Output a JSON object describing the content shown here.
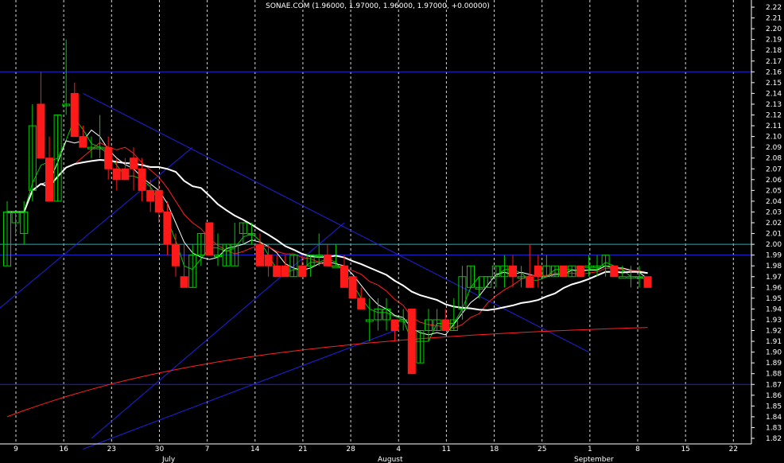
{
  "chart_data": {
    "type": "candlestick",
    "title": "SONAE.COM (1.96000, 1.97000, 1.96000, 1.97000, +0.00000)",
    "y_ticks": [
      "2.22",
      "2.21",
      "2.20",
      "2.19",
      "2.18",
      "2.17",
      "2.16",
      "2.15",
      "2.14",
      "2.13",
      "2.12",
      "2.11",
      "2.10",
      "2.09",
      "2.08",
      "2.07",
      "2.06",
      "2.05",
      "2.04",
      "2.03",
      "2.02",
      "2.01",
      "2.00",
      "1.99",
      "1.98",
      "1.97",
      "1.96",
      "1.95",
      "1.94",
      "1.93",
      "1.92",
      "1.91",
      "1.90",
      "1.89",
      "1.88",
      "1.87",
      "1.86",
      "1.85",
      "1.84",
      "1.83",
      "1.82"
    ],
    "ylim": [
      1.82,
      2.22
    ],
    "x_day_ticks": [
      "9",
      "16",
      "23",
      "30",
      "7",
      "14",
      "21",
      "28",
      "4",
      "11",
      "18",
      "25",
      "1",
      "8",
      "15",
      "22"
    ],
    "x_month_ticks": [
      "July",
      "August",
      "September"
    ],
    "grid": "vertical dotted",
    "candles": [
      {
        "o": 1.98,
        "h": 2.04,
        "l": 1.98,
        "c": 2.03
      },
      {
        "o": 2.02,
        "h": 2.03,
        "l": 2.01,
        "c": 2.03
      },
      {
        "o": 2.01,
        "h": 2.04,
        "l": 2.0,
        "c": 2.03
      },
      {
        "o": 2.05,
        "h": 2.13,
        "l": 2.04,
        "c": 2.11
      },
      {
        "o": 2.13,
        "h": 2.16,
        "l": 2.08,
        "c": 2.08
      },
      {
        "o": 2.08,
        "h": 2.1,
        "l": 2.04,
        "c": 2.04
      },
      {
        "o": 2.04,
        "h": 2.12,
        "l": 2.04,
        "c": 2.12
      },
      {
        "o": 2.13,
        "h": 2.19,
        "l": 2.12,
        "c": 2.13
      },
      {
        "o": 2.14,
        "h": 2.15,
        "l": 2.1,
        "c": 2.1
      },
      {
        "o": 2.1,
        "h": 2.11,
        "l": 2.09,
        "c": 2.09
      },
      {
        "o": 2.09,
        "h": 2.1,
        "l": 2.08,
        "c": 2.09
      },
      {
        "o": 2.09,
        "h": 2.12,
        "l": 2.08,
        "c": 2.09
      },
      {
        "o": 2.09,
        "h": 2.1,
        "l": 2.06,
        "c": 2.07
      },
      {
        "o": 2.07,
        "h": 2.08,
        "l": 2.05,
        "c": 2.06
      },
      {
        "o": 2.07,
        "h": 2.08,
        "l": 2.06,
        "c": 2.06
      },
      {
        "o": 2.08,
        "h": 2.09,
        "l": 2.05,
        "c": 2.07
      },
      {
        "o": 2.07,
        "h": 2.08,
        "l": 2.04,
        "c": 2.05
      },
      {
        "o": 2.05,
        "h": 2.06,
        "l": 2.03,
        "c": 2.04
      },
      {
        "o": 2.05,
        "h": 2.06,
        "l": 2.02,
        "c": 2.03
      },
      {
        "o": 2.03,
        "h": 2.04,
        "l": 1.99,
        "c": 2.0
      },
      {
        "o": 2.0,
        "h": 2.01,
        "l": 1.97,
        "c": 1.98
      },
      {
        "o": 1.97,
        "h": 2.0,
        "l": 1.96,
        "c": 1.96
      },
      {
        "o": 1.96,
        "h": 2.0,
        "l": 1.96,
        "c": 1.99
      },
      {
        "o": 1.99,
        "h": 2.01,
        "l": 1.98,
        "c": 2.01
      },
      {
        "o": 2.02,
        "h": 2.02,
        "l": 1.99,
        "c": 1.99
      },
      {
        "o": 1.99,
        "h": 2.01,
        "l": 1.98,
        "c": 1.99
      },
      {
        "o": 1.98,
        "h": 2.0,
        "l": 1.98,
        "c": 2.0
      },
      {
        "o": 1.98,
        "h": 2.02,
        "l": 1.98,
        "c": 2.0
      },
      {
        "o": 2.01,
        "h": 2.02,
        "l": 2.0,
        "c": 2.02
      },
      {
        "o": 2.01,
        "h": 2.02,
        "l": 2.0,
        "c": 2.01
      },
      {
        "o": 2.0,
        "h": 2.01,
        "l": 1.98,
        "c": 1.98
      },
      {
        "o": 1.99,
        "h": 2.0,
        "l": 1.97,
        "c": 1.98
      },
      {
        "o": 1.98,
        "h": 1.99,
        "l": 1.97,
        "c": 1.97
      },
      {
        "o": 1.98,
        "h": 1.99,
        "l": 1.97,
        "c": 1.97
      },
      {
        "o": 1.97,
        "h": 1.99,
        "l": 1.97,
        "c": 1.99
      },
      {
        "o": 1.98,
        "h": 1.99,
        "l": 1.97,
        "c": 1.97
      },
      {
        "o": 1.98,
        "h": 1.99,
        "l": 1.97,
        "c": 1.99
      },
      {
        "o": 1.99,
        "h": 2.01,
        "l": 1.98,
        "c": 1.99
      },
      {
        "o": 1.99,
        "h": 2.0,
        "l": 1.98,
        "c": 1.98
      },
      {
        "o": 1.98,
        "h": 2.0,
        "l": 1.98,
        "c": 1.98
      },
      {
        "o": 1.98,
        "h": 1.99,
        "l": 1.96,
        "c": 1.96
      },
      {
        "o": 1.97,
        "h": 1.97,
        "l": 1.95,
        "c": 1.95
      },
      {
        "o": 1.95,
        "h": 1.96,
        "l": 1.94,
        "c": 1.94
      },
      {
        "o": 1.93,
        "h": 1.95,
        "l": 1.91,
        "c": 1.93
      },
      {
        "o": 1.93,
        "h": 1.95,
        "l": 1.92,
        "c": 1.94
      },
      {
        "o": 1.93,
        "h": 1.95,
        "l": 1.92,
        "c": 1.94
      },
      {
        "o": 1.93,
        "h": 1.93,
        "l": 1.91,
        "c": 1.92
      },
      {
        "o": 1.93,
        "h": 1.94,
        "l": 1.92,
        "c": 1.93
      },
      {
        "o": 1.94,
        "h": 1.94,
        "l": 1.88,
        "c": 1.88
      },
      {
        "o": 1.89,
        "h": 1.92,
        "l": 1.89,
        "c": 1.92
      },
      {
        "o": 1.92,
        "h": 1.94,
        "l": 1.91,
        "c": 1.93
      },
      {
        "o": 1.92,
        "h": 1.94,
        "l": 1.92,
        "c": 1.93
      },
      {
        "o": 1.93,
        "h": 1.94,
        "l": 1.92,
        "c": 1.92
      },
      {
        "o": 1.92,
        "h": 1.95,
        "l": 1.92,
        "c": 1.93
      },
      {
        "o": 1.94,
        "h": 1.98,
        "l": 1.93,
        "c": 1.97
      },
      {
        "o": 1.96,
        "h": 1.98,
        "l": 1.96,
        "c": 1.98
      },
      {
        "o": 1.96,
        "h": 1.97,
        "l": 1.95,
        "c": 1.96
      },
      {
        "o": 1.96,
        "h": 1.97,
        "l": 1.96,
        "c": 1.97
      },
      {
        "o": 1.97,
        "h": 1.98,
        "l": 1.96,
        "c": 1.98
      },
      {
        "o": 1.97,
        "h": 1.99,
        "l": 1.96,
        "c": 1.98
      },
      {
        "o": 1.98,
        "h": 1.99,
        "l": 1.96,
        "c": 1.97
      },
      {
        "o": 1.97,
        "h": 1.98,
        "l": 1.96,
        "c": 1.97
      },
      {
        "o": 1.97,
        "h": 2.0,
        "l": 1.96,
        "c": 1.96
      },
      {
        "o": 1.98,
        "h": 1.99,
        "l": 1.96,
        "c": 1.97
      },
      {
        "o": 1.97,
        "h": 1.99,
        "l": 1.97,
        "c": 1.98
      },
      {
        "o": 1.97,
        "h": 1.98,
        "l": 1.97,
        "c": 1.98
      },
      {
        "o": 1.98,
        "h": 1.98,
        "l": 1.97,
        "c": 1.97
      },
      {
        "o": 1.97,
        "h": 1.98,
        "l": 1.97,
        "c": 1.98
      },
      {
        "o": 1.98,
        "h": 1.98,
        "l": 1.97,
        "c": 1.97
      },
      {
        "o": 1.98,
        "h": 1.99,
        "l": 1.97,
        "c": 1.98
      },
      {
        "o": 1.98,
        "h": 1.99,
        "l": 1.97,
        "c": 1.98
      },
      {
        "o": 1.98,
        "h": 1.99,
        "l": 1.97,
        "c": 1.99
      },
      {
        "o": 1.98,
        "h": 1.98,
        "l": 1.97,
        "c": 1.97
      },
      {
        "o": 1.97,
        "h": 1.98,
        "l": 1.97,
        "c": 1.97
      },
      {
        "o": 1.97,
        "h": 1.98,
        "l": 1.96,
        "c": 1.97
      },
      {
        "o": 1.97,
        "h": 1.98,
        "l": 1.96,
        "c": 1.97
      },
      {
        "o": 1.97,
        "h": 1.97,
        "l": 1.96,
        "c": 1.96
      }
    ],
    "horizontal_levels": [
      {
        "value": 2.16,
        "color": "#2222dd"
      },
      {
        "value": 2.0,
        "color": "#20b0b0"
      },
      {
        "value": 1.99,
        "color": "#2222dd"
      },
      {
        "value": 1.87,
        "color": "#2222dd"
      }
    ],
    "colors": {
      "background": "#000000",
      "up_candle": "#00cc00",
      "down_candle": "#ff1a1a",
      "highlight_up": "#00ff40",
      "ma_fast": "#ffffff",
      "ma_green": "#00cc00",
      "ma_red": "#ff2020",
      "ma_slow": "#ffffff",
      "ma_long": "#ff2020",
      "trendline": "#2020e0",
      "axis": "#ffffff"
    }
  }
}
